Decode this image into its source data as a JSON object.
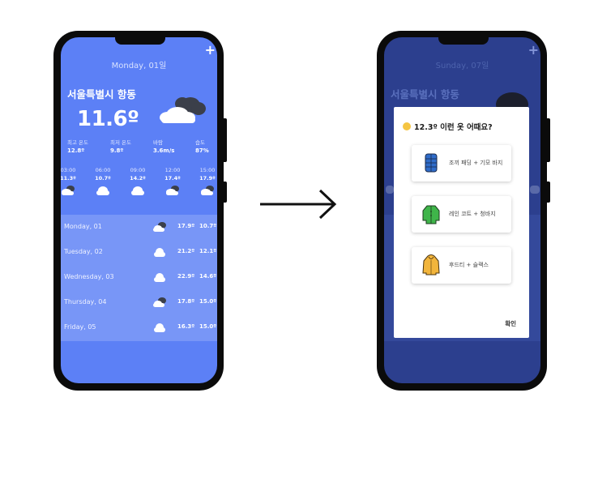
{
  "left_phone": {
    "date": "Monday, 01일",
    "plus": "+",
    "city": "서울특별시 항동",
    "temperature": "11.6º",
    "stats": [
      {
        "label": "최고 온도",
        "value": "12.8º"
      },
      {
        "label": "최저 온도",
        "value": "9.8º"
      },
      {
        "label": "바람",
        "value": "3.6m/s"
      },
      {
        "label": "습도",
        "value": "87%"
      }
    ],
    "hourly": [
      {
        "time": "03:00",
        "temp": "11.3º",
        "icon": "cloud-dark-icon"
      },
      {
        "time": "06:00",
        "temp": "10.7º",
        "icon": "cloud-icon"
      },
      {
        "time": "09:00",
        "temp": "14.2º",
        "icon": "cloud-icon"
      },
      {
        "time": "12:00",
        "temp": "17.4º",
        "icon": "cloud-dark-icon"
      },
      {
        "time": "15:00",
        "temp": "17.9º",
        "icon": "cloud-dark-icon"
      }
    ],
    "daily": [
      {
        "day": "Monday, 01",
        "high": "17.9º",
        "low": "10.7º",
        "icon": "cloud-dark-icon"
      },
      {
        "day": "Tuesday, 02",
        "high": "21.2º",
        "low": "12.1º",
        "icon": "cloud-icon"
      },
      {
        "day": "Wednesday, 03",
        "high": "22.9º",
        "low": "14.6º",
        "icon": "cloud-icon"
      },
      {
        "day": "Thursday, 04",
        "high": "17.8º",
        "low": "15.0º",
        "icon": "cloud-dark-icon"
      },
      {
        "day": "Friday, 05",
        "high": "16.3º",
        "low": "15.0º",
        "icon": "cloud-icon"
      }
    ]
  },
  "right_phone": {
    "date": "Sunday, 07일",
    "plus": "+",
    "city": "서울특별시 항동",
    "dialog": {
      "title": "12.3º 이런 옷 어때요?",
      "options": [
        {
          "label": "조끼 패딩 + 기모 바지",
          "icon": "padded-vest-icon"
        },
        {
          "label": "레인 코트 + 청바지",
          "icon": "raincoat-icon"
        },
        {
          "label": "후드티 + 슬랙스",
          "icon": "hoodie-icon"
        }
      ],
      "confirm": "확인"
    }
  },
  "colors": {
    "screen_blue": "#5c80f6",
    "daily_panel": "#7896f7",
    "dimmed_screen": "#2c3f8e"
  }
}
